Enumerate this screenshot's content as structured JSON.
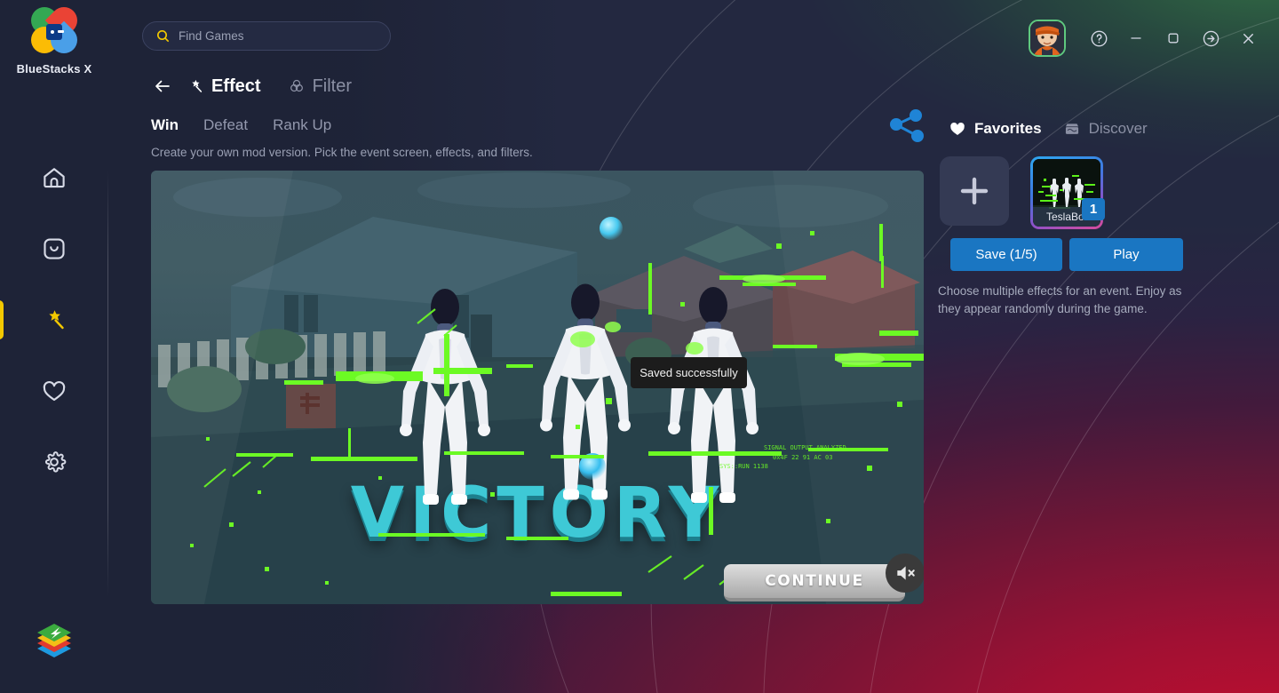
{
  "app": {
    "brand_name": "BlueStacks X",
    "logo_icon": "bluestacks-petal-logo",
    "footer_logo_icon": "bluestacks-stack-logo"
  },
  "search": {
    "placeholder": "Find Games",
    "value": "",
    "icon": "search-icon",
    "icon_color": "#f2c800"
  },
  "window_controls": {
    "avatar_icon": "user-avatar",
    "help_label": "?",
    "items": [
      {
        "name": "help-button",
        "icon": "question-circle-icon"
      },
      {
        "name": "minimize-button",
        "icon": "minimize-icon"
      },
      {
        "name": "maximize-button",
        "icon": "maximize-icon"
      },
      {
        "name": "popout-button",
        "icon": "arrow-right-circle-icon"
      },
      {
        "name": "close-button",
        "icon": "close-icon"
      }
    ]
  },
  "sidebar": {
    "active_index": 2,
    "active_color": "#f2c800",
    "items": [
      {
        "label": "Home",
        "icon": "home-icon",
        "active": false
      },
      {
        "label": "My Games",
        "icon": "app-box-icon",
        "active": false
      },
      {
        "label": "Effects",
        "icon": "magic-wand-icon",
        "active": true
      },
      {
        "label": "Favorites",
        "icon": "heart-icon",
        "active": false
      },
      {
        "label": "Settings",
        "icon": "gear-icon",
        "active": false
      }
    ]
  },
  "subheader": {
    "back_icon": "arrow-left-icon",
    "modes": [
      {
        "label": "Effect",
        "icon": "magic-wand-icon",
        "active": true
      },
      {
        "label": "Filter",
        "icon": "three-circles-icon",
        "active": false
      }
    ]
  },
  "event_tabs": {
    "active": "Win",
    "items": [
      {
        "label": "Win",
        "active": true
      },
      {
        "label": "Defeat",
        "active": false
      },
      {
        "label": "Rank Up",
        "active": false
      }
    ]
  },
  "subtitle": "Create your own mod version. Pick the event screen, effects, and filters.",
  "toast": {
    "message": "Saved successfully"
  },
  "preview": {
    "headline": "VICTORY",
    "headline_color": "#3ec9d6",
    "continue_label": "CONTINUE",
    "mute_icon": "speaker-mute-icon",
    "scene_description": "Suburban neighborhood with three white humanoid robots"
  },
  "right_panel": {
    "share_icon": "share-nodes-icon",
    "share_color": "#1f84d6",
    "tabs": [
      {
        "label": "Favorites",
        "icon": "heart-filled-icon",
        "active": true
      },
      {
        "label": "Discover",
        "icon": "store-icon",
        "active": false
      }
    ],
    "add_card": {
      "label": "Add",
      "icon": "plus-icon"
    },
    "effect_cards": [
      {
        "name": "TeslaBot",
        "badge": "1",
        "selected": true
      }
    ],
    "buttons": {
      "save_label": "Save (1/5)",
      "play_label": "Play",
      "accent_color": "#1a76c2"
    },
    "helper_text": "Choose multiple effects for an event. Enjoy as they appear randomly during the game."
  }
}
